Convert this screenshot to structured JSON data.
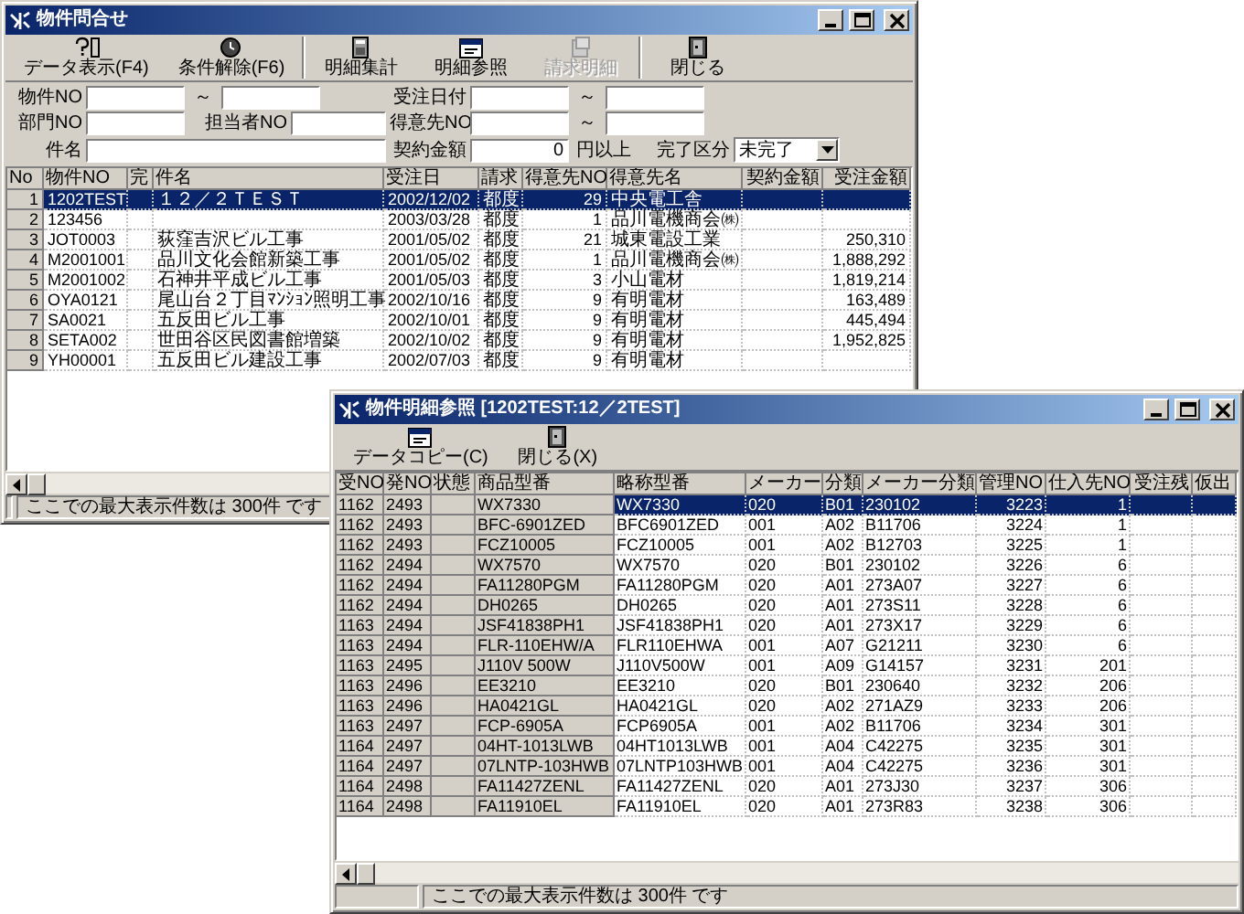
{
  "main_window": {
    "title": "物件問合せ",
    "toolbar": [
      {
        "buttons": [
          {
            "label": "データ表示(F4)",
            "disabled": false
          },
          {
            "label": "条件解除(F6)",
            "disabled": false
          }
        ]
      },
      {
        "buttons": [
          {
            "label": "明細集計",
            "disabled": false
          },
          {
            "label": "明細参照",
            "disabled": false
          },
          {
            "label": "請求明細",
            "disabled": true
          }
        ]
      },
      {
        "buttons": [
          {
            "label": "閉じる",
            "disabled": false
          }
        ]
      }
    ],
    "filters": {
      "property_no": {
        "label": "物件NO",
        "range_sep": "～"
      },
      "order_date": {
        "label": "受注日付",
        "range_sep": "～"
      },
      "department_no": {
        "label": "部門NO"
      },
      "staff_no": {
        "label": "担当者NO"
      },
      "customer_no": {
        "label": "得意先NO",
        "range_sep": "～"
      },
      "subject": {
        "label": "件名"
      },
      "contract_amount": {
        "label": "契約金額",
        "value": "0",
        "suffix": "円以上"
      },
      "completion": {
        "label": "完了区分",
        "value": "未完了"
      }
    },
    "table": {
      "columns": [
        "No",
        "物件NO",
        "完",
        "件名",
        "受注日",
        "請求",
        "得意先NO",
        "得意先名",
        "契約金額",
        "受注金額"
      ],
      "rows": [
        {
          "no": "1",
          "property_no": "1202TEST",
          "name": "１２／２ＴＥＳＴ",
          "order_date": "2002/12/02",
          "billing": "都度",
          "customer_no": "29",
          "customer_name": "中央電工舎",
          "selected": true
        },
        {
          "no": "2",
          "property_no": "123456",
          "order_date": "2003/03/28",
          "billing": "都度",
          "customer_no": "1",
          "customer_name": "品川電機商会㈱",
          "selected": false
        },
        {
          "no": "3",
          "property_no": "JOT0003",
          "name": "荻窪吉沢ビル工事",
          "order_date": "2001/05/02",
          "billing": "都度",
          "customer_no": "21",
          "customer_name": "城東電設工業",
          "order_amount": "250,310",
          "selected": false
        },
        {
          "no": "4",
          "property_no": "M2001001",
          "name": "品川文化会館新築工事",
          "order_date": "2001/05/02",
          "billing": "都度",
          "customer_no": "1",
          "customer_name": "品川電機商会㈱",
          "order_amount": "1,888,292",
          "selected": false
        },
        {
          "no": "5",
          "property_no": "M2001002",
          "name": "石神井平成ビル工事",
          "order_date": "2001/05/03",
          "billing": "都度",
          "customer_no": "3",
          "customer_name": "小山電材",
          "order_amount": "1,819,214",
          "selected": false
        },
        {
          "no": "6",
          "property_no": "OYA0121",
          "name": "尾山台２丁目ﾏﾝｼｮﾝ照明工事",
          "order_date": "2002/10/16",
          "billing": "都度",
          "customer_no": "9",
          "customer_name": "有明電材",
          "order_amount": "163,489",
          "selected": false
        },
        {
          "no": "7",
          "property_no": "SA0021",
          "name": "五反田ビル工事",
          "order_date": "2002/10/01",
          "billing": "都度",
          "customer_no": "9",
          "customer_name": "有明電材",
          "order_amount": "445,494",
          "selected": false
        },
        {
          "no": "8",
          "property_no": "SETA002",
          "name": "世田谷区民図書館増築",
          "order_date": "2002/10/02",
          "billing": "都度",
          "customer_no": "9",
          "customer_name": "有明電材",
          "order_amount": "1,952,825",
          "selected": false
        },
        {
          "no": "9",
          "property_no": "YH00001",
          "name": "五反田ビル建設工事",
          "order_date": "2002/07/03",
          "billing": "都度",
          "customer_no": "9",
          "customer_name": "有明電材",
          "selected": false
        }
      ]
    },
    "status_bar": "ここでの最大表示件数は 300件 です"
  },
  "detail_window": {
    "title": "物件明細参照 [1202TEST:12／2TEST]",
    "toolbar": [
      {
        "buttons": [
          {
            "label": "データコピー(C)",
            "disabled": false
          },
          {
            "label": "閉じる(X)",
            "disabled": false
          }
        ]
      }
    ],
    "table": {
      "columns": [
        "受NO",
        "発NO",
        "状態",
        "商品型番",
        "略称型番",
        "メーカー",
        "分類",
        "メーカー分類",
        "管理NO",
        "仕入先NO",
        "受注残",
        "仮出"
      ],
      "rows": [
        {
          "order_no": "1162",
          "po_no": "2493",
          "product_code": "WX7330",
          "short_code": "WX7330",
          "maker": "020",
          "category": "B01",
          "maker_category": "230102",
          "control_no": "3223",
          "supplier_no": "1",
          "selected": true
        },
        {
          "order_no": "1162",
          "po_no": "2493",
          "product_code": "BFC-6901ZED",
          "short_code": "BFC6901ZED",
          "maker": "001",
          "category": "A02",
          "maker_category": "B11706",
          "control_no": "3224",
          "supplier_no": "1",
          "selected": false
        },
        {
          "order_no": "1162",
          "po_no": "2493",
          "product_code": "FCZ10005",
          "short_code": "FCZ10005",
          "maker": "001",
          "category": "A02",
          "maker_category": "B12703",
          "control_no": "3225",
          "supplier_no": "1",
          "selected": false
        },
        {
          "order_no": "1162",
          "po_no": "2494",
          "product_code": "WX7570",
          "short_code": "WX7570",
          "maker": "020",
          "category": "B01",
          "maker_category": "230102",
          "control_no": "3226",
          "supplier_no": "6",
          "selected": false
        },
        {
          "order_no": "1162",
          "po_no": "2494",
          "product_code": "FA11280PGM",
          "short_code": "FA11280PGM",
          "maker": "020",
          "category": "A01",
          "maker_category": "273A07",
          "control_no": "3227",
          "supplier_no": "6",
          "selected": false
        },
        {
          "order_no": "1162",
          "po_no": "2494",
          "product_code": "DH0265",
          "short_code": "DH0265",
          "maker": "020",
          "category": "A01",
          "maker_category": "273S11",
          "control_no": "3228",
          "supplier_no": "6",
          "selected": false
        },
        {
          "order_no": "1163",
          "po_no": "2494",
          "product_code": "JSF41838PH1",
          "short_code": "JSF41838PH1",
          "maker": "020",
          "category": "A01",
          "maker_category": "273X17",
          "control_no": "3229",
          "supplier_no": "6",
          "selected": false
        },
        {
          "order_no": "1163",
          "po_no": "2494",
          "product_code": "FLR-110EHW/A",
          "short_code": "FLR110EHWA",
          "maker": "001",
          "category": "A07",
          "maker_category": "G21211",
          "control_no": "3230",
          "supplier_no": "6",
          "selected": false
        },
        {
          "order_no": "1163",
          "po_no": "2495",
          "product_code": "J110V 500W",
          "short_code": "J110V500W",
          "maker": "001",
          "category": "A09",
          "maker_category": "G14157",
          "control_no": "3231",
          "supplier_no": "201",
          "selected": false
        },
        {
          "order_no": "1163",
          "po_no": "2496",
          "product_code": "EE3210",
          "short_code": "EE3210",
          "maker": "020",
          "category": "B01",
          "maker_category": "230640",
          "control_no": "3232",
          "supplier_no": "206",
          "selected": false
        },
        {
          "order_no": "1163",
          "po_no": "2496",
          "product_code": "HA0421GL",
          "short_code": "HA0421GL",
          "maker": "020",
          "category": "A02",
          "maker_category": "271AZ9",
          "control_no": "3233",
          "supplier_no": "206",
          "selected": false
        },
        {
          "order_no": "1163",
          "po_no": "2497",
          "product_code": "FCP-6905A",
          "short_code": "FCP6905A",
          "maker": "001",
          "category": "A02",
          "maker_category": "B11706",
          "control_no": "3234",
          "supplier_no": "301",
          "selected": false
        },
        {
          "order_no": "1164",
          "po_no": "2497",
          "product_code": "04HT-1013LWB",
          "short_code": "04HT1013LWB",
          "maker": "001",
          "category": "A04",
          "maker_category": "C42275",
          "control_no": "3235",
          "supplier_no": "301",
          "selected": false
        },
        {
          "order_no": "1164",
          "po_no": "2497",
          "product_code": "07LNTP-103HWB",
          "short_code": "07LNTP103HWB",
          "maker": "001",
          "category": "A04",
          "maker_category": "C42275",
          "control_no": "3236",
          "supplier_no": "301",
          "selected": false
        },
        {
          "order_no": "1164",
          "po_no": "2498",
          "product_code": "FA11427ZENL",
          "short_code": "FA11427ZENL",
          "maker": "020",
          "category": "A01",
          "maker_category": "273J30",
          "control_no": "3237",
          "supplier_no": "306",
          "selected": false
        },
        {
          "order_no": "1164",
          "po_no": "2498",
          "product_code": "FA11910EL",
          "short_code": "FA11910EL",
          "maker": "020",
          "category": "A01",
          "maker_category": "273R83",
          "control_no": "3238",
          "supplier_no": "306",
          "selected": false
        }
      ]
    },
    "status_bar": "ここでの最大表示件数は 300件 です"
  }
}
